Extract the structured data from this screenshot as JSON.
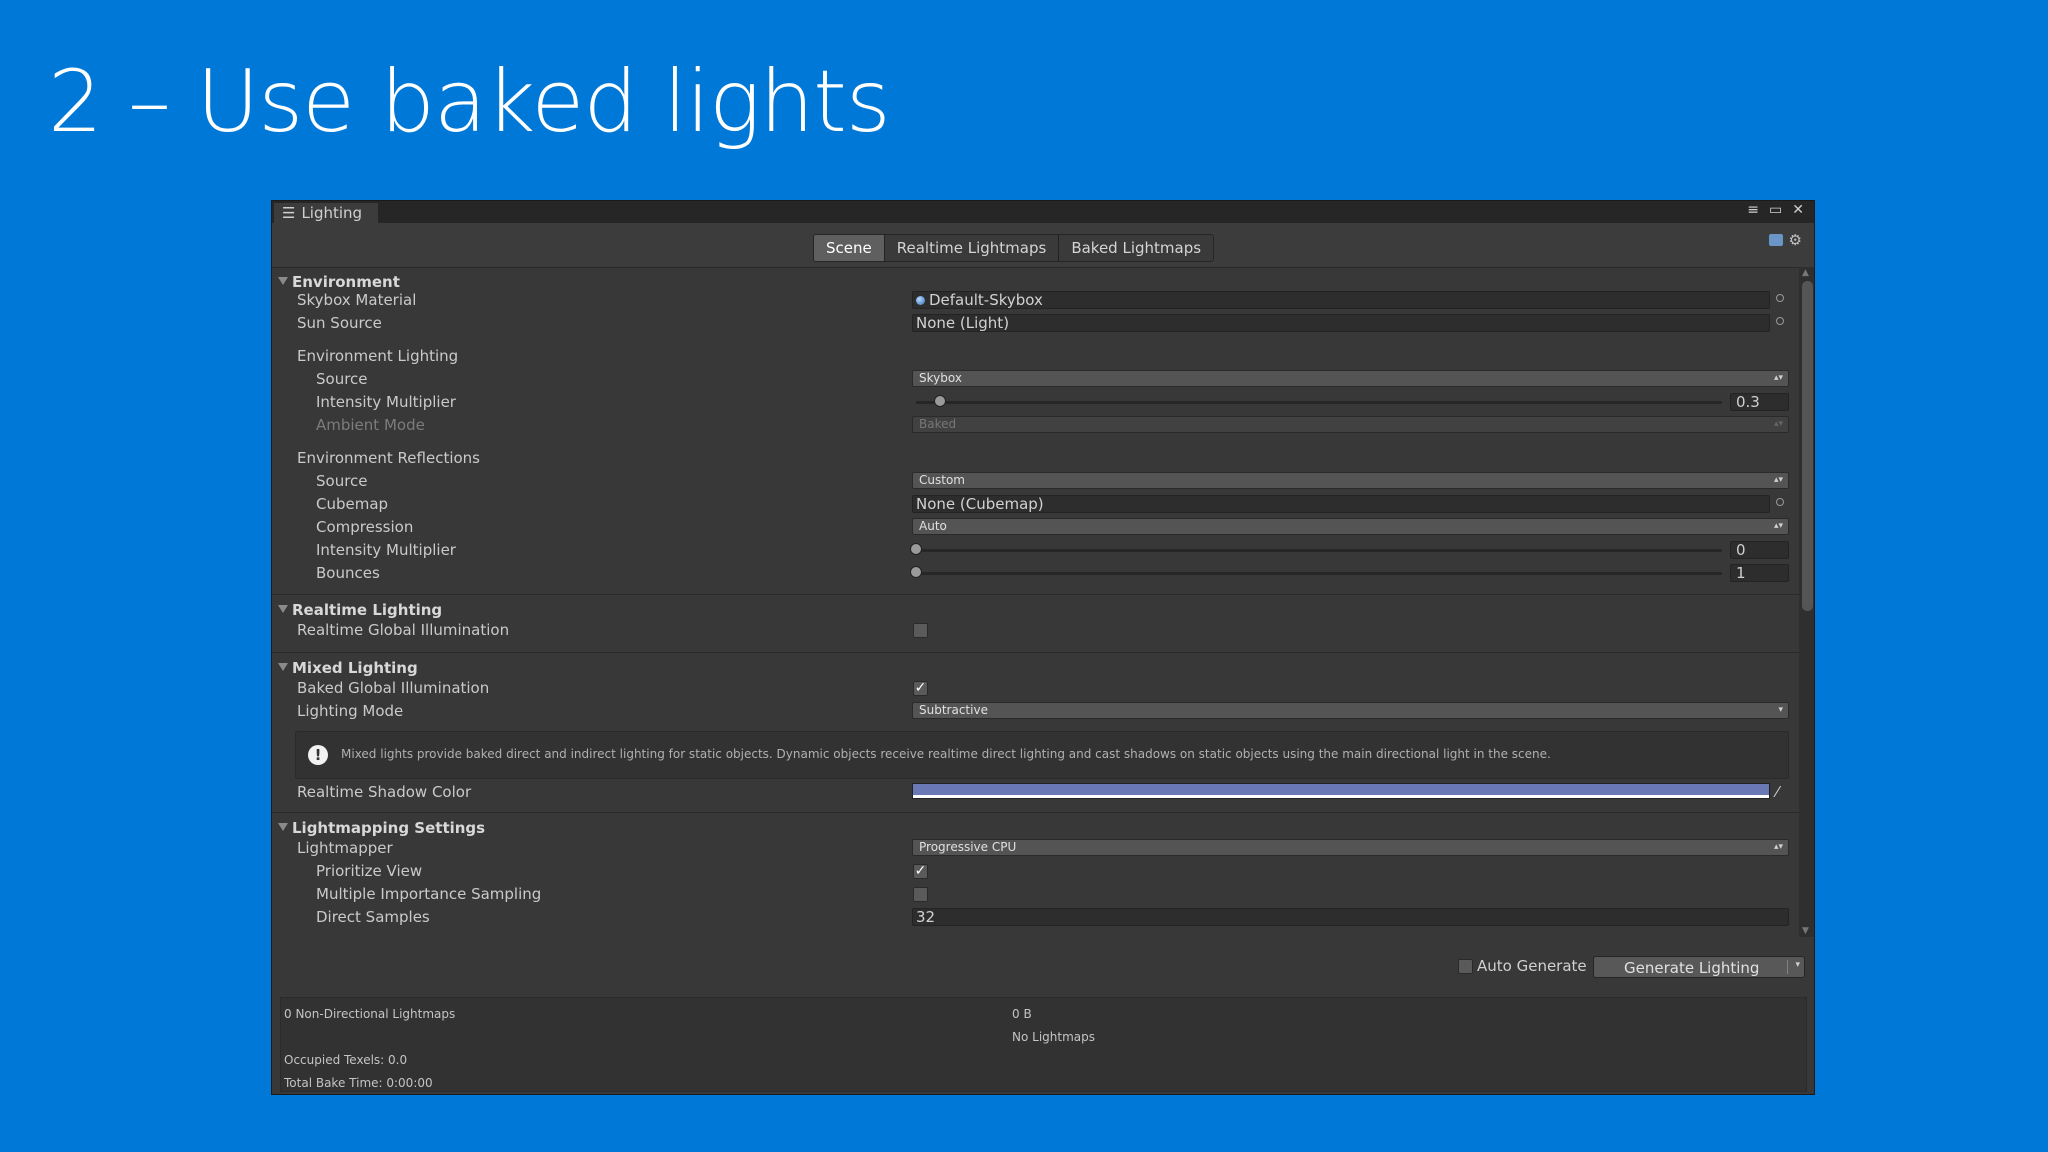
{
  "slide": {
    "title": "2 – Use baked lights"
  },
  "window": {
    "tab_label": "Lighting"
  },
  "tabs": [
    "Scene",
    "Realtime Lightmaps",
    "Baked Lightmaps"
  ],
  "environment": {
    "header": "Environment",
    "skybox_material": {
      "label": "Skybox Material",
      "value": "Default-Skybox"
    },
    "sun_source": {
      "label": "Sun Source",
      "value": "None (Light)"
    },
    "lighting": {
      "label": "Environment Lighting",
      "source": {
        "label": "Source",
        "value": "Skybox"
      },
      "intensity": {
        "label": "Intensity Multiplier",
        "value": "0.3",
        "fraction": 0.03
      },
      "ambient_mode": {
        "label": "Ambient Mode",
        "value": "Baked"
      }
    },
    "reflections": {
      "label": "Environment Reflections",
      "source": {
        "label": "Source",
        "value": "Custom"
      },
      "cubemap": {
        "label": "Cubemap",
        "value": "None (Cubemap)"
      },
      "compression": {
        "label": "Compression",
        "value": "Auto"
      },
      "intensity": {
        "label": "Intensity Multiplier",
        "value": "0",
        "fraction": 0.0
      },
      "bounces": {
        "label": "Bounces",
        "value": "1",
        "fraction": 0.0
      }
    }
  },
  "realtime": {
    "header": "Realtime Lighting",
    "gi": {
      "label": "Realtime Global Illumination",
      "checked": false
    }
  },
  "mixed": {
    "header": "Mixed Lighting",
    "baked_gi": {
      "label": "Baked Global Illumination",
      "checked": true
    },
    "mode": {
      "label": "Lighting Mode",
      "value": "Subtractive"
    },
    "help": "Mixed lights provide baked direct and indirect lighting for static objects. Dynamic objects receive realtime direct lighting and cast shadows on static objects using the main directional light in the scene.",
    "shadow_color": {
      "label": "Realtime Shadow Color",
      "color": "#6a78b5"
    }
  },
  "lightmapping": {
    "header": "Lightmapping Settings",
    "lightmapper": {
      "label": "Lightmapper",
      "value": "Progressive CPU"
    },
    "prioritize_view": {
      "label": "Prioritize View",
      "checked": true
    },
    "mis": {
      "label": "Multiple Importance Sampling",
      "checked": false
    },
    "direct_samples": {
      "label": "Direct Samples",
      "value": "32"
    }
  },
  "bottom": {
    "auto_generate": "Auto Generate",
    "generate_button": "Generate Lighting"
  },
  "stats": {
    "lightmaps": "0 Non-Directional Lightmaps",
    "size": "0 B",
    "no_lightmaps": "No Lightmaps",
    "texels": "Occupied Texels: 0.0",
    "bake_time": "Total Bake Time: 0:00:00"
  },
  "icons": {
    "window": "list-icon",
    "close": "close-icon",
    "maximize": "maximize-icon",
    "menu": "menu-icon",
    "help": "book-icon",
    "settings": "gear-icon",
    "picker": "object-picker-icon",
    "eyedropper": "eyedropper-icon",
    "warning": "exclamation-icon"
  },
  "colors": {
    "background": "#0078d7",
    "panel": "#383838"
  }
}
